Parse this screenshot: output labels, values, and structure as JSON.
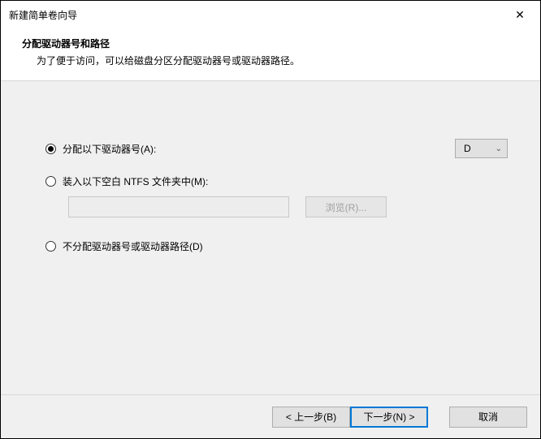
{
  "window": {
    "title": "新建简单卷向导",
    "close_symbol": "✕"
  },
  "header": {
    "heading": "分配驱动器号和路径",
    "sub": "为了便于访问，可以给磁盘分区分配驱动器号或驱动器路径。"
  },
  "options": {
    "assign_letter": {
      "label": "分配以下驱动器号(A):",
      "selected_drive": "D",
      "checked": true
    },
    "mount_folder": {
      "label": "装入以下空白 NTFS 文件夹中(M):",
      "path_value": "",
      "browse_label": "浏览(R)...",
      "checked": false
    },
    "no_assign": {
      "label": "不分配驱动器号或驱动器路径(D)",
      "checked": false
    }
  },
  "footer": {
    "back": "< 上一步(B)",
    "next": "下一步(N) >",
    "cancel": "取消"
  }
}
